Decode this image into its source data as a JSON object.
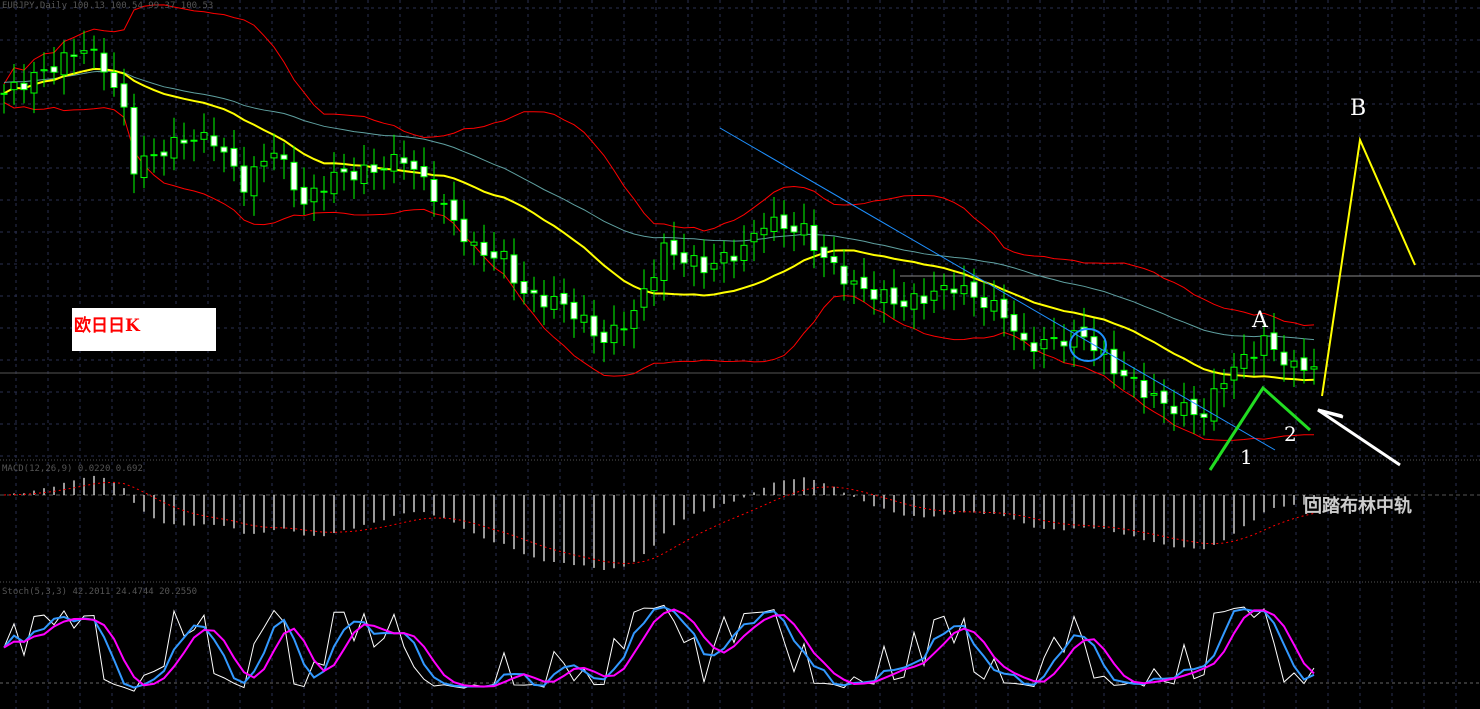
{
  "header": {
    "main_title": "EURJPY,Daily 100.13 100.54 99.37 100.53",
    "macd_title": "MACD(12,26,9) 0.0220 0.692",
    "stoch_title": "Stoch(5,3,3) 42.2011 24.4744 20.2550"
  },
  "label_box": "欧日日K",
  "annotations": {
    "A": "A",
    "B": "B",
    "one": "1",
    "two": "2",
    "note": "回踏布林中轨"
  },
  "colors": {
    "bull": "#00ff00",
    "bear": "#ffffff",
    "ma": "#ffff00",
    "bands": "#ff0000",
    "ema": "#5fa0a0",
    "trend": "#1e90ff",
    "stoch_k": "#3399ff",
    "stoch_d": "#ff00ff"
  },
  "chart_data": {
    "type": "candlestick",
    "title": "EURJPY Daily",
    "ylim": [
      96,
      120
    ],
    "close_keypoints": [
      [
        0,
        116
      ],
      [
        5,
        117.5
      ],
      [
        8,
        118.5
      ],
      [
        10,
        117.5
      ],
      [
        12,
        115
      ],
      [
        13,
        112
      ],
      [
        18,
        113.5
      ],
      [
        21,
        113.5
      ],
      [
        24,
        111
      ],
      [
        27,
        113
      ],
      [
        30,
        110
      ],
      [
        33,
        111.5
      ],
      [
        37,
        111.8
      ],
      [
        40,
        112.5
      ],
      [
        43,
        110.5
      ],
      [
        47,
        107.5
      ],
      [
        50,
        107
      ],
      [
        52,
        105
      ],
      [
        56,
        104.5
      ],
      [
        60,
        102.5
      ],
      [
        63,
        104
      ],
      [
        66,
        107.5
      ],
      [
        70,
        106.5
      ],
      [
        74,
        107.5
      ],
      [
        76,
        109
      ],
      [
        80,
        108.5
      ],
      [
        82,
        107
      ],
      [
        85,
        105.5
      ],
      [
        90,
        104.5
      ],
      [
        95,
        105.5
      ],
      [
        100,
        104
      ],
      [
        102,
        102.2
      ],
      [
        108,
        102.8
      ],
      [
        111,
        101
      ],
      [
        116,
        99
      ],
      [
        120,
        98.5
      ],
      [
        122,
        100.5
      ],
      [
        126,
        102.5
      ],
      [
        129,
        101
      ],
      [
        131,
        101.2
      ]
    ],
    "indicators": [
      "MA20",
      "Bollinger(20,2)",
      "EMA",
      "MACD(12,26,9)",
      "Stoch(5,3,3)"
    ]
  }
}
